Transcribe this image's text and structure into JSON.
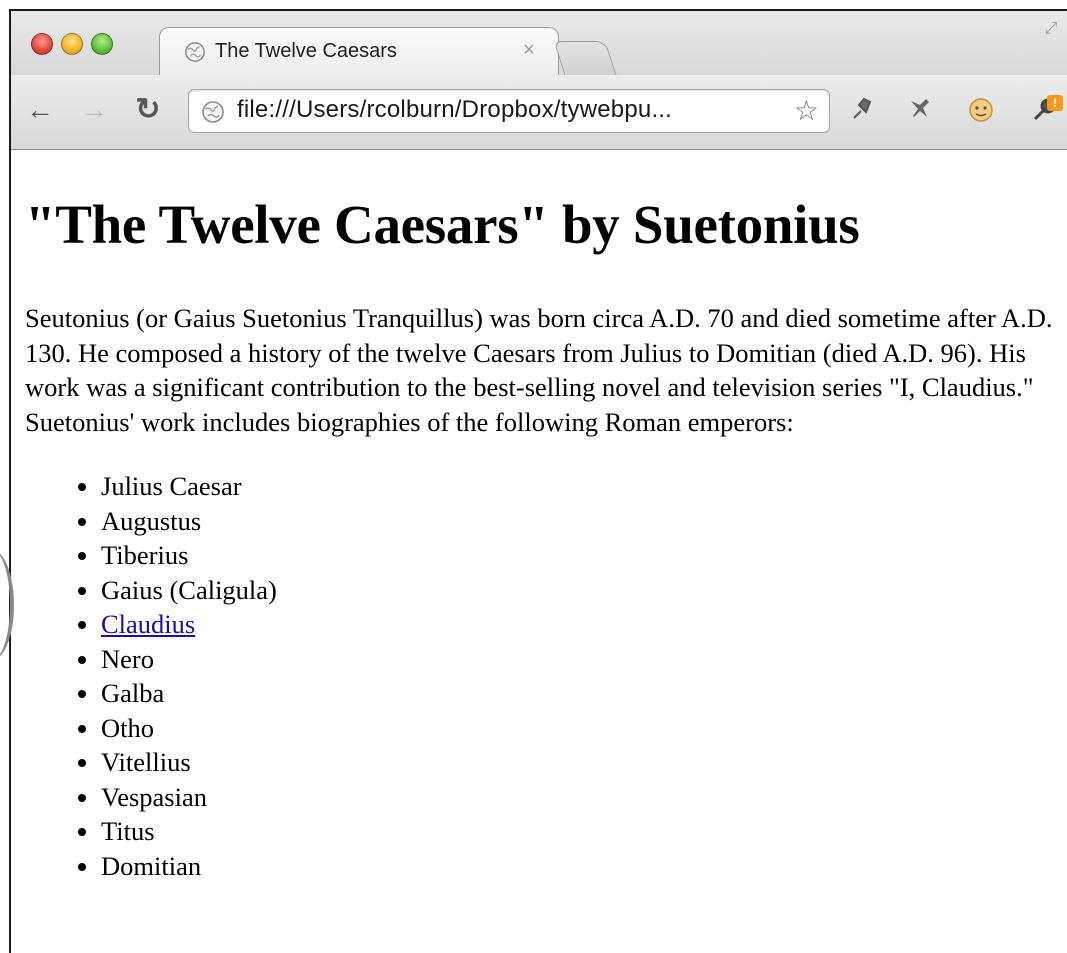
{
  "browser": {
    "tab": {
      "title": "The Twelve Caesars",
      "close_glyph": "×"
    },
    "address_bar": {
      "url": "file:///Users/rcolburn/Dropbox/tywebpu..."
    }
  },
  "page": {
    "heading": "\"The Twelve Caesars\" by Suetonius",
    "intro": "Seutonius (or Gaius Suetonius Tranquillus) was born circa A.D. 70 and died sometime after A.D. 130. He composed a history of the twelve Caesars from Julius to Domitian (died A.D. 96). His work was a significant contribution to the best-selling novel and television series \"I, Claudius.\" Suetonius' work includes biographies of the following Roman emperors:",
    "emperors": [
      {
        "name": "Julius Caesar"
      },
      {
        "name": "Augustus"
      },
      {
        "name": "Tiberius"
      },
      {
        "name": "Gaius (Caligula)"
      },
      {
        "name": "Claudius",
        "link": true
      },
      {
        "name": "Nero"
      },
      {
        "name": "Galba"
      },
      {
        "name": "Otho"
      },
      {
        "name": "Vitellius"
      },
      {
        "name": "Vespasian"
      },
      {
        "name": "Titus"
      },
      {
        "name": "Domitian"
      }
    ]
  },
  "icons": {
    "back": "back-arrow-icon",
    "forward": "forward-arrow-icon",
    "reload": "reload-icon",
    "globe": "globe-icon",
    "star": "star-icon",
    "wrench": "wrench-icon"
  },
  "colors": {
    "link": "#1a0dab",
    "close_light": "#e2463b",
    "minimize_light": "#f0b429",
    "zoom_light": "#5bbf3b",
    "badge": "#f39a19"
  }
}
